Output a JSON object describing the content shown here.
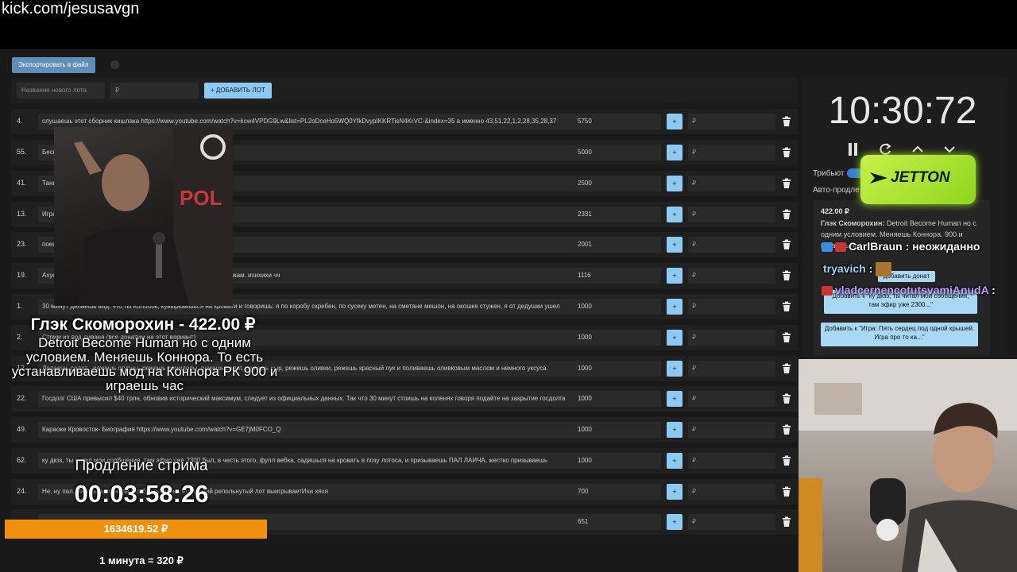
{
  "overlay_url": "kick.com/jesusavgn",
  "toolbar": {
    "export_label": "Экспортировать в файл"
  },
  "add_lot": {
    "name_placeholder": "Название нового лота",
    "rub_placeholder": "₽",
    "add_label": "+ ДОБАВИТЬ ЛОТ"
  },
  "lots": [
    {
      "num": "4.",
      "desc": "слушаешь этот сборник кишлака https://www.youtube.com/watch?v=kcw4VPDG9Lw&list=PL2oDceHo5WQ0YfkDvypIKKRTisN4KrVC-&index=35 а именно 43,51,22,1,2,28,35,28,37",
      "amount": "5750",
      "plus": "+",
      "rub": "₽"
    },
    {
      "num": "55.",
      "desc": "Бесплатн",
      "amount": "5000",
      "plus": "+",
      "rub": "₽"
    },
    {
      "num": "41.",
      "desc": "Танцуешь                                                             ашки крылышки / какашки в кармашки",
      "amount": "2500",
      "plus": "+",
      "rub": "₽"
    },
    {
      "num": "13.",
      "desc": "Играешь",
      "amount": "2331",
      "plus": "+",
      "rub": "₽"
    },
    {
      "num": "23.",
      "desc": "поешь",
      "amount": "2001",
      "plus": "+",
      "rub": "₽"
    },
    {
      "num": "19.",
      "desc": "Ахуенно                                                             башить. артой. по. лыгыдышкам. Лыгыдышкам крылышкам. ихихихи чч",
      "amount": "1116",
      "plus": "+",
      "rub": "₽"
    },
    {
      "num": "1.",
      "desc": "30 минут делаешь вид, что ты Колобок, кувыркаешься на кровати и говоришь: я по коробу скребен, по сусеку метен, на сметане мешон, на окошке стужен, я от дедушки ушел",
      "amount": "1000",
      "plus": "+",
      "rub": "₽"
    },
    {
      "num": "2.",
      "desc": "Стрим из под дивана (все донатим на этот вариант)",
      "amount": "1000",
      "plus": "+",
      "rub": "₽"
    },
    {
      "num": "12.",
      "desc": "Делаешь салат - режешь огурцы, режешь помидоры, режешь салат, режешь сыр, режешь оливки, режешь красный лук и поливаешь оливковым маслом и немного уксуса.",
      "amount": "1000",
      "plus": "+",
      "rub": "₽"
    },
    {
      "num": "22.",
      "desc": "Госдолг США превысил $40 трлн, обновив исторический максимум, следует из официальных данных. Так что 30 минут стоишь на коленях говоря подайте на закрытие госдолга",
      "amount": "1000",
      "plus": "+",
      "rub": "₽"
    },
    {
      "num": "49.",
      "desc": "Караоке Кровосток- Биография https://www.youtube.com/watch?v=GE7jM0FCO_Q",
      "amount": "1000",
      "plus": "+",
      "rub": "₽"
    },
    {
      "num": "62.",
      "desc": "ку дкзз, ты читал мои сообщения, там эфир уже 2300 был, в честь этого, фулл вебка, садишься на кровать в позу лотоса, и призываешь ПАЛ ЛАИЧА, жестко призываешь",
      "amount": "1000",
      "plus": "+",
      "rub": "₽"
    },
    {
      "num": "24.",
      "desc": "Не, ну                                                     пал, теперь пиво не за что братьЗакинь что третий репольнутый лот выигрываетИхи хяхя",
      "amount": "700",
      "plus": "+",
      "rub": "₽"
    },
    {
      "num": "",
      "desc": "",
      "amount": "651",
      "plus": "+",
      "rub": "₽"
    }
  ],
  "timer": {
    "value": "10:30:72",
    "tribute_label": "Трибьют",
    "auto_label": "Авто-продле"
  },
  "sponsor": {
    "name": "JETTON"
  },
  "donation": {
    "amount": "422.00 ₽",
    "author": "Глэк Скоморохин:",
    "text": "Detroit Become Human но с одним условием. Меняешь Коннора. 900 и играешь час",
    "add_btn_1": "Добавить к \"ку дкзз, ты читал мои сообщения, там эфир уже 2300...\"",
    "add_btn_2": "Добавить к \"Игра: Пять сердец под одной крышей. Игра про то ка...\"",
    "add_btn_small": "добавить донат"
  },
  "chat": [
    {
      "user": "CarlBraun",
      "sep": " : ",
      "message": "неожиданно"
    },
    {
      "user": "tryavich",
      "sep": " : ",
      "message": ""
    },
    {
      "user": "vladcernencotutsvamiAnudA",
      "sep": " :",
      "message": ""
    }
  ],
  "overlay": {
    "donor_title": "Глэк Скоморохин - 422.00 ₽",
    "donor_msg": "Detroit Become Human но с одним условием. Меняешь Коннора. То есть устанавливаешь мод на Коннора РК 900 и играешь час",
    "extension_label": "Продление стрима",
    "extension_timer": "00:03:58:26",
    "total": "1634619.52 ₽",
    "rate": "1 минута = 320 ₽"
  },
  "colors": {
    "accent": "#8ec9f2",
    "total_bar": "#f0900f",
    "sponsor": "#a6e034"
  }
}
